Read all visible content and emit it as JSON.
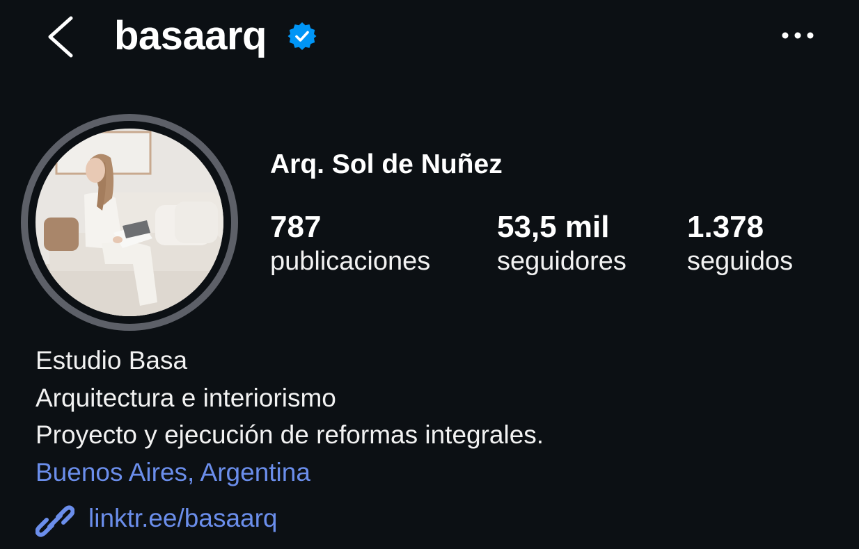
{
  "header": {
    "username": "basaarq",
    "back_icon": "chevron-left-icon",
    "verified_icon": "verified-badge-icon",
    "more_icon": "more-horizontal-icon"
  },
  "profile": {
    "display_name": "Arq. Sol de Nuñez",
    "avatar": "profile-photo"
  },
  "stats": [
    {
      "value": "787",
      "label": "publicaciones"
    },
    {
      "value": "53,5 mil",
      "label": "seguidores"
    },
    {
      "value": "1.378",
      "label": "seguidos"
    }
  ],
  "bio": {
    "lines": [
      "Estudio Basa",
      "Arquitectura e interiorismo",
      "Proyecto y ejecución de reformas integrales."
    ],
    "location": "Buenos Aires, Argentina",
    "link": "linktr.ee/basaarq",
    "link_icon": "link-icon"
  },
  "colors": {
    "background": "#0c1014",
    "text": "#f5f5f5",
    "link": "#6b8eeb",
    "verified": "#0095f6",
    "avatar_ring": "#5d6068"
  }
}
